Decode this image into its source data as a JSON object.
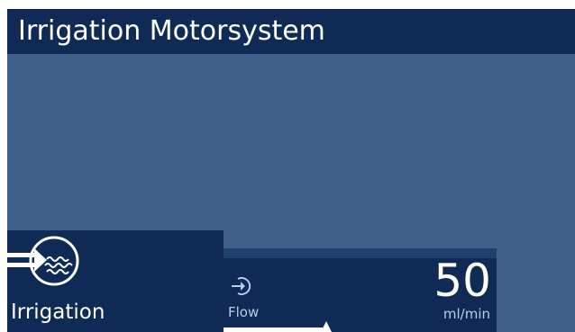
{
  "header": {
    "title": "Irrigation Motorsystem"
  },
  "mode_button": {
    "label": "Irrigation",
    "icon": "irrigation-icon"
  },
  "flow_panel": {
    "label": "Flow",
    "icon": "flow-icon",
    "value": "50",
    "unit": "ml/min"
  },
  "colors": {
    "background": "#3f5f88",
    "header": "#0f2b55",
    "panel": "#0f2b55",
    "text": "#ffffff",
    "secondary_text": "#b8cbe6"
  }
}
